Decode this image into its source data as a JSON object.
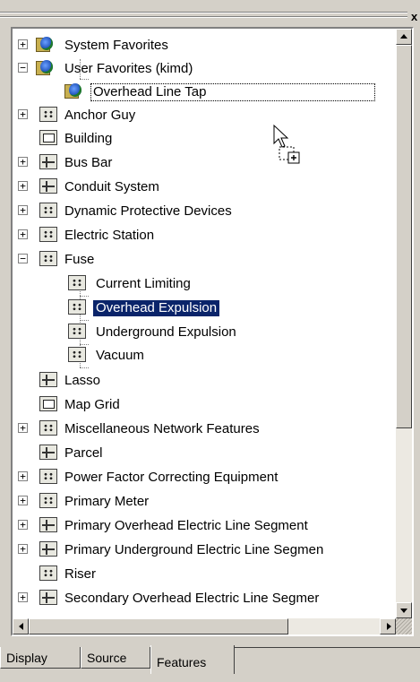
{
  "panel": {
    "close_glyph": "x"
  },
  "tree": {
    "items": [
      {
        "label": "System Favorites",
        "expander": "+",
        "icon": "globe-icon"
      },
      {
        "label": "User Favorites (kimd)",
        "expander": "−",
        "icon": "globe-icon"
      },
      {
        "label": "Overhead Line Tap",
        "icon": "globe-icon",
        "state": "drag-target"
      },
      {
        "label": "Anchor Guy",
        "expander": "+",
        "icon": "dots-icon"
      },
      {
        "label": "Building",
        "icon": "grid-icon"
      },
      {
        "label": "Bus Bar",
        "expander": "+",
        "icon": "line-icon"
      },
      {
        "label": "Conduit System",
        "expander": "+",
        "icon": "line-icon"
      },
      {
        "label": "Dynamic Protective Devices",
        "expander": "+",
        "icon": "dots-icon"
      },
      {
        "label": "Electric Station",
        "expander": "+",
        "icon": "dots-icon"
      },
      {
        "label": "Fuse",
        "expander": "−",
        "icon": "dots-icon"
      },
      {
        "label": "Current Limiting",
        "icon": "dots-icon"
      },
      {
        "label": "Overhead Expulsion",
        "icon": "dots-icon",
        "state": "selected"
      },
      {
        "label": "Underground Expulsion",
        "icon": "dots-icon"
      },
      {
        "label": "Vacuum",
        "icon": "dots-icon"
      },
      {
        "label": "Lasso",
        "icon": "line-icon"
      },
      {
        "label": "Map Grid",
        "icon": "grid-icon"
      },
      {
        "label": "Miscellaneous Network Features",
        "expander": "+",
        "icon": "dots-icon"
      },
      {
        "label": "Parcel",
        "icon": "line-icon"
      },
      {
        "label": "Power Factor Correcting Equipment",
        "expander": "+",
        "icon": "dots-icon"
      },
      {
        "label": "Primary Meter",
        "expander": "+",
        "icon": "dots-icon"
      },
      {
        "label": "Primary Overhead Electric Line Segment",
        "expander": "+",
        "icon": "line-icon"
      },
      {
        "label": "Primary Underground Electric Line Segmen",
        "expander": "+",
        "icon": "line-icon"
      },
      {
        "label": "Riser",
        "icon": "dots-icon"
      },
      {
        "label": "Secondary Overhead Electric Line Segmer",
        "expander": "+",
        "icon": "line-icon"
      }
    ]
  },
  "tabs": [
    {
      "label": "Display"
    },
    {
      "label": "Source"
    },
    {
      "label": "Features",
      "active": true
    }
  ]
}
